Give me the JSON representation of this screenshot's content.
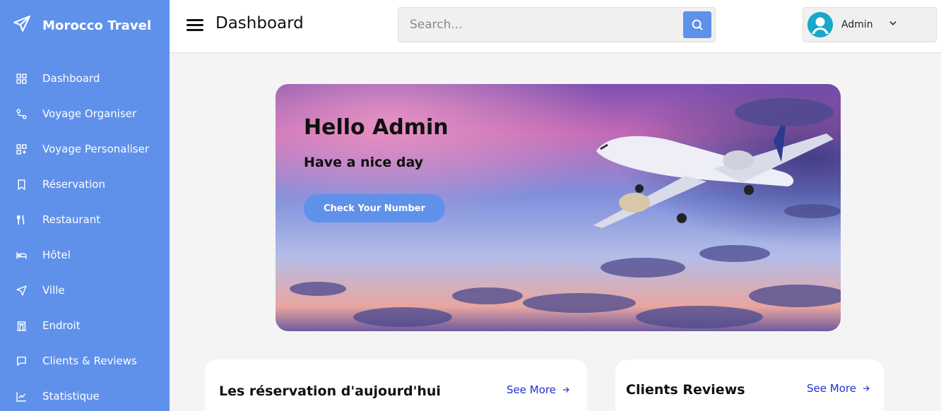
{
  "sidebar": {
    "brand": "Morocco Travel",
    "items": [
      {
        "label": "Dashboard",
        "icon": "grid-icon"
      },
      {
        "label": "Voyage Organiser",
        "icon": "route-icon"
      },
      {
        "label": "Voyage Personaliser",
        "icon": "grid-plus-icon"
      },
      {
        "label": "Réservation",
        "icon": "bookmark-icon"
      },
      {
        "label": "Restaurant",
        "icon": "utensils-icon"
      },
      {
        "label": "Hôtel",
        "icon": "bed-icon"
      },
      {
        "label": "Ville",
        "icon": "navigation-icon"
      },
      {
        "label": "Endroit",
        "icon": "monument-icon"
      },
      {
        "label": "Clients & Reviews",
        "icon": "chat-icon"
      },
      {
        "label": "Statistique",
        "icon": "chart-icon"
      }
    ]
  },
  "header": {
    "title": "Dashboard",
    "search_placeholder": "Search...",
    "user_name": "Admin"
  },
  "hero": {
    "title": "Hello Admin",
    "subtitle": "Have a nice day",
    "button_label": "Check Your Number"
  },
  "cards": [
    {
      "title": "Les réservation d'aujourd'hui",
      "link": "See More"
    },
    {
      "title": "Clients Reviews",
      "link": "See More"
    }
  ],
  "colors": {
    "accent": "#5f91eb",
    "link": "#1f2fd1"
  }
}
